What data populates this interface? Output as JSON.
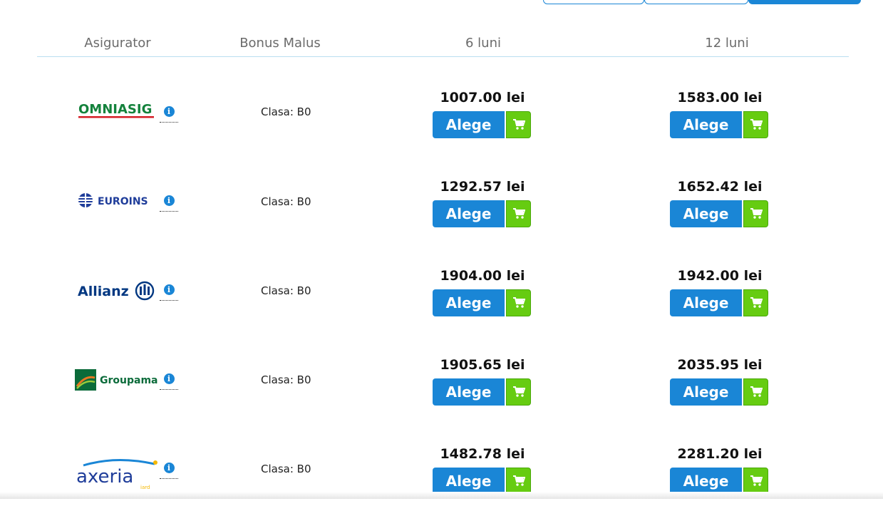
{
  "headers": {
    "insurer": "Asigurator",
    "bonus": "Bonus Malus",
    "m6": "6 luni",
    "m12": "12 luni"
  },
  "colors": {
    "primary": "#1a86d6",
    "cart_green": "#66cc11",
    "divider": "#b9dff0"
  },
  "rows": [
    {
      "insurer": "OMNIASIG",
      "bonus": "Clasa: B0",
      "price6": "1007.00 lei",
      "price12": "1583.00 lei",
      "button": "Alege"
    },
    {
      "insurer": "EUROINS",
      "bonus": "Clasa: B0",
      "price6": "1292.57 lei",
      "price12": "1652.42 lei",
      "button": "Alege"
    },
    {
      "insurer": "Allianz",
      "bonus": "Clasa: B0",
      "price6": "1904.00 lei",
      "price12": "1942.00 lei",
      "button": "Alege"
    },
    {
      "insurer": "Groupama",
      "bonus": "Clasa: B0",
      "price6": "1905.65 lei",
      "price12": "2035.95 lei",
      "button": "Alege"
    },
    {
      "insurer": "axeria",
      "insurer_sub": "iard",
      "bonus": "Clasa: B0",
      "price6": "1482.78 lei",
      "price12": "2281.20 lei",
      "button": "Alege"
    }
  ],
  "info_glyph": "i"
}
